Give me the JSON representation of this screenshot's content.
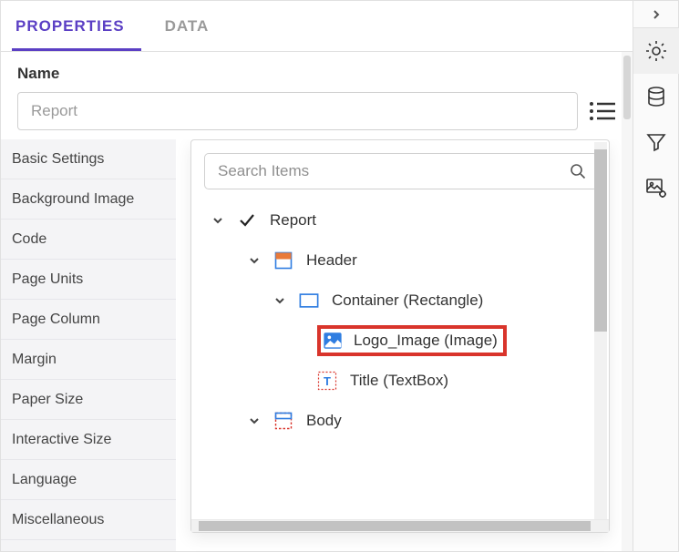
{
  "tabs": {
    "properties": "PROPERTIES",
    "data": "DATA"
  },
  "name": {
    "label": "Name",
    "value": "Report"
  },
  "settings": [
    "Basic Settings",
    "Background Image",
    "Code",
    "Page Units",
    "Page Column",
    "Margin",
    "Paper Size",
    "Interactive Size",
    "Language",
    "Miscellaneous"
  ],
  "popup": {
    "search_placeholder": "Search Items",
    "tree": {
      "root": "Report",
      "header": "Header",
      "container": "Container (Rectangle)",
      "logo": "Logo_Image (Image)",
      "title": "Title (TextBox)",
      "body": "Body"
    }
  }
}
